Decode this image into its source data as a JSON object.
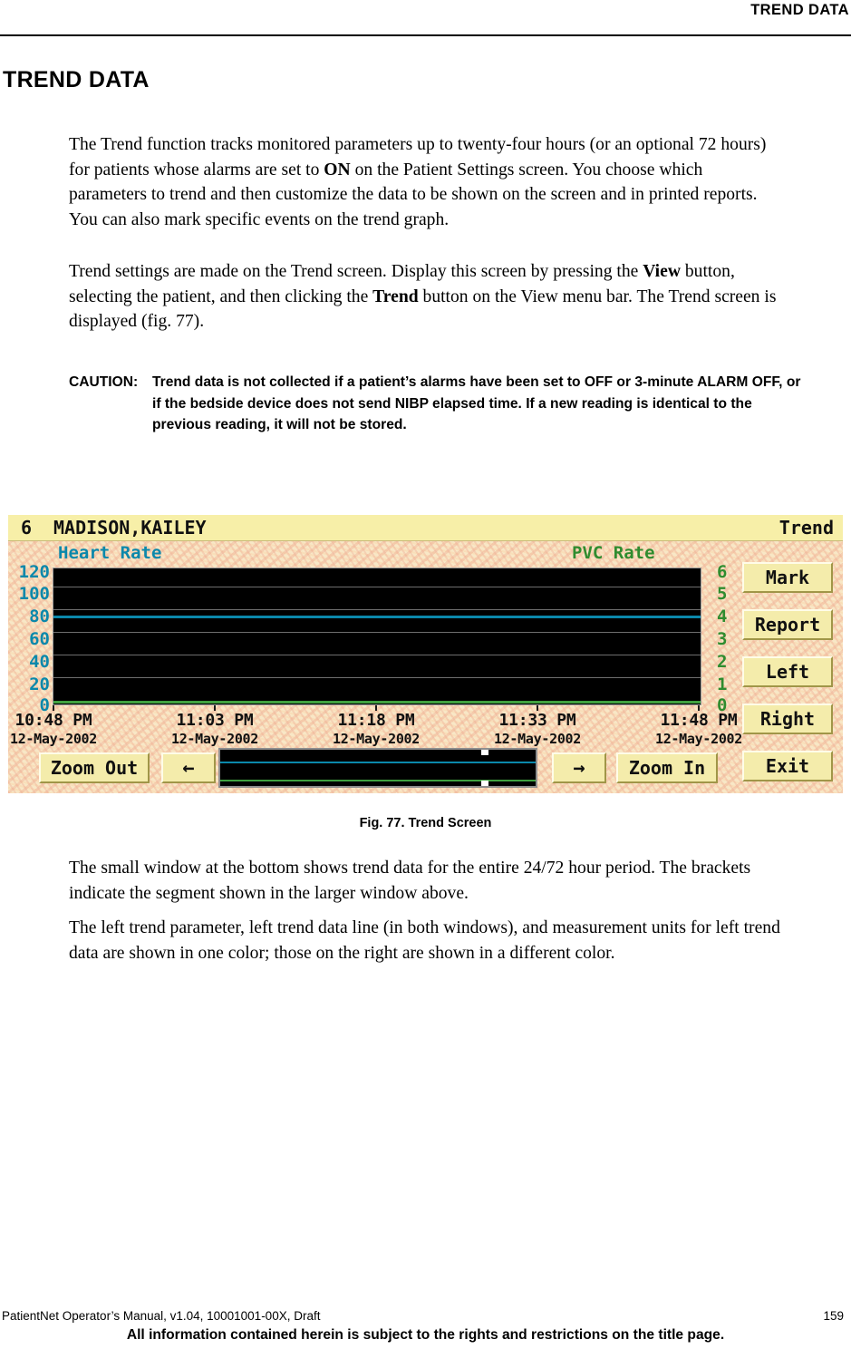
{
  "running_header": {
    "title": "TREND DATA"
  },
  "chapter": {
    "title": "TREND DATA"
  },
  "body": {
    "p1_a": "The Trend function tracks monitored parameters up to twenty-four hours (or an optional 72 hours) for patients whose alarms are set to ",
    "p1_b": "ON",
    "p1_c": " on the Patient Settings screen. You choose which parameters to trend and then customize the data to be shown on the screen and in printed reports. You can also mark specific events on the trend graph.",
    "p2_a": "Trend settings are made on the Trend screen. Display this screen by pressing the ",
    "p2_b": "View",
    "p2_c": " button, selecting the patient, and then clicking the ",
    "p2_d": "Trend",
    "p2_e": " button on the View menu bar. The Trend screen is displayed (fig. 77).",
    "p3": "The small window at the bottom shows trend data for the entire 24/72 hour period. The brackets indicate the segment shown in the larger window above.",
    "p4": "The left trend parameter, left trend data line (in both windows), and measurement units for left trend data are shown in one color; those on the right are shown in a different color."
  },
  "caution": {
    "label": "CAUTION:",
    "text": "Trend data is not collected if a patient’s alarms have been set to OFF or 3-minute ALARM OFF, or if the bedside device does not send NIBP elapsed time. If a new reading is identical to the previous reading, it will not be stored."
  },
  "figure": {
    "caption": "Fig. 77. Trend Screen",
    "titlebar": {
      "bed_number": "6",
      "patient_name": "MADISON,KAILEY",
      "screen_name": "Trend"
    },
    "param_left_label": "Heart Rate",
    "param_right_label": "PVC Rate",
    "buttons": [
      {
        "name": "mark",
        "label": "Mark"
      },
      {
        "name": "report",
        "label": "Report"
      },
      {
        "name": "left",
        "label": "Left"
      },
      {
        "name": "right",
        "label": "Right"
      },
      {
        "name": "exit",
        "label": "Exit"
      }
    ],
    "bottom_buttons": {
      "zoom_out": "Zoom Out",
      "scroll_left": "←",
      "scroll_right": "→",
      "zoom_in": "Zoom In"
    },
    "colors": {
      "left_series": "#0b88ab",
      "right_series": "#3fa03f",
      "titlebar": "#f7efa8",
      "button_face": "#f4ecab",
      "plot_background": "#000000",
      "gridline": "#6e6e6e",
      "panel_background": "#f8e7c6"
    }
  },
  "chart_data": {
    "type": "line",
    "title": "Trend Screen — Heart Rate / PVC Rate",
    "xlabel": "",
    "ylabel": "Heart Rate",
    "y2label": "PVC Rate",
    "grid": true,
    "legend": "none",
    "ylim": [
      0,
      130
    ],
    "y2lim": [
      0,
      6
    ],
    "y_ticks": [
      120,
      100,
      80,
      60,
      40,
      20,
      0
    ],
    "y2_ticks": [
      6,
      5,
      4,
      3,
      2,
      1,
      0
    ],
    "x_tick_labels": [
      {
        "time": "10:48 PM",
        "date": "12-May-2002"
      },
      {
        "time": "11:03 PM",
        "date": "12-May-2002"
      },
      {
        "time": "11:18 PM",
        "date": "12-May-2002"
      },
      {
        "time": "11:33 PM",
        "date": "12-May-2002"
      },
      {
        "time": "11:48 PM",
        "date": "12-May-2002"
      }
    ],
    "series": [
      {
        "name": "Heart Rate",
        "color": "#0b88ab",
        "axis": "left",
        "constant_value": 80,
        "values": [
          80,
          80,
          80,
          80,
          80
        ]
      },
      {
        "name": "PVC Rate",
        "color": "#3fa03f",
        "axis": "right",
        "constant_value": 0,
        "values": [
          0,
          0,
          0,
          0,
          0
        ]
      }
    ],
    "overview": {
      "description": "Small window showing entire 24/72 hour period",
      "series": [
        {
          "name": "Heart Rate",
          "color": "#0b88ab",
          "constant_value": 80
        },
        {
          "name": "PVC Rate",
          "color": "#3fa03f",
          "constant_value": 0
        }
      ],
      "bracket_position_percent": 83
    }
  },
  "footer": {
    "left": "PatientNet Operator’s Manual, v1.04, 10001001-00X, Draft",
    "page": "159",
    "note": "All information contained herein is subject to the rights and restrictions on the title page."
  }
}
